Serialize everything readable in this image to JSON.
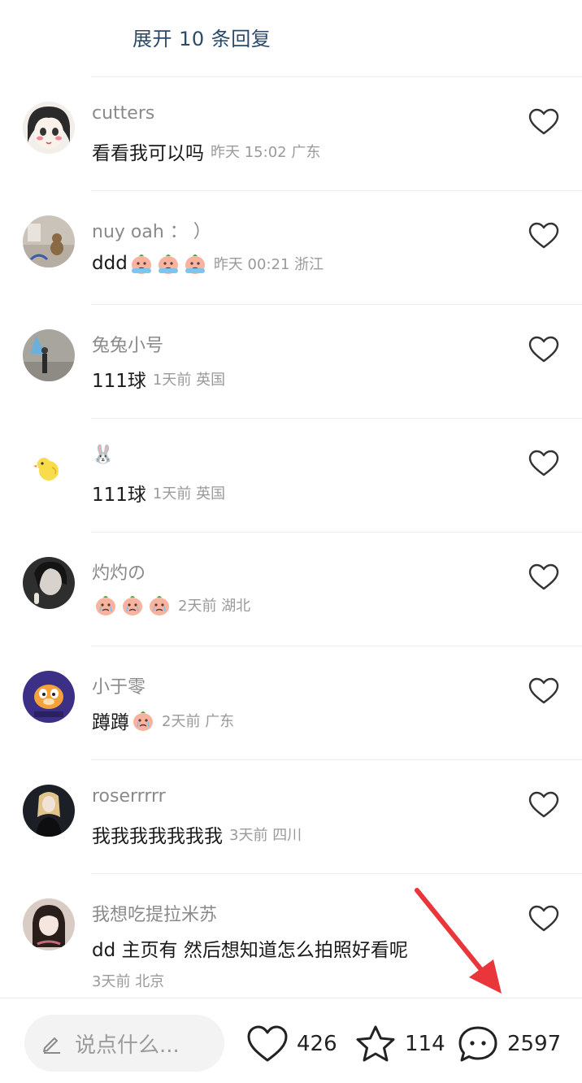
{
  "expand_replies": "展开 10 条回复",
  "comments": [
    {
      "username": "cutters",
      "text": "看看我可以吗",
      "emoji_count": 0,
      "time": "昨天 15:02",
      "location": "广东",
      "avatar": "anime-girl"
    },
    {
      "username": "nuy oah ：  ）",
      "text": "ddd",
      "emoji_count": 3,
      "time": "昨天 00:21",
      "location": "浙江",
      "avatar": "room-photo"
    },
    {
      "username": "兔兔小号",
      "text": "111球",
      "emoji_count": 0,
      "time": "1天前",
      "location": "英国",
      "avatar": "blue-light"
    },
    {
      "username": "🐰",
      "text": "111球",
      "emoji_count": 0,
      "time": "1天前",
      "location": "英国",
      "avatar": "yellow-chick"
    },
    {
      "username": "灼灼の",
      "text": "",
      "emoji_count": 3,
      "time": "2天前",
      "location": "湖北",
      "avatar": "dark-selfie"
    },
    {
      "username": "小于零",
      "text": "蹲蹲",
      "emoji_count": 1,
      "time": "2天前",
      "location": "广东",
      "avatar": "garfield"
    },
    {
      "username": "roserrrrr",
      "text": "我我我我我我我",
      "emoji_count": 0,
      "time": "3天前",
      "location": "四川",
      "avatar": "night-portrait"
    },
    {
      "username": "我想吃提拉米苏",
      "text": "dd 主页有 然后想知道怎么拍照好看呢",
      "emoji_count": 0,
      "time": "3天前",
      "location": "北京",
      "avatar": "girl-photo",
      "meta_below": true
    }
  ],
  "bottom_bar": {
    "input_placeholder": "说点什么...",
    "likes": "426",
    "favorites": "114",
    "comments": "2597"
  },
  "colors": {
    "expand_text": "#2b4a6b",
    "username": "#8a8a8a",
    "meta": "#9a9a9a",
    "annotation_arrow": "#e8363a"
  }
}
